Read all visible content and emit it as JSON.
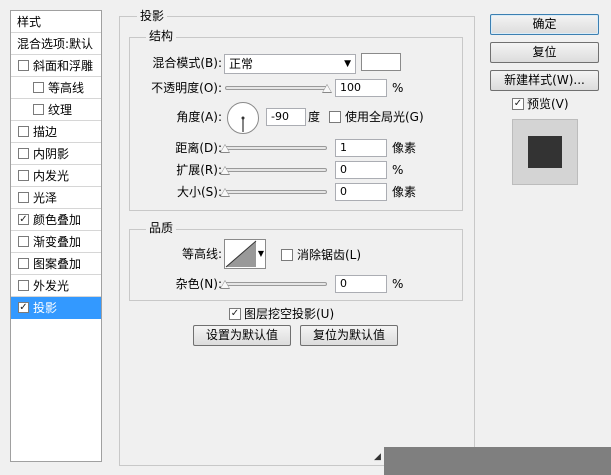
{
  "sidebar": {
    "header": "样式",
    "blend_options": "混合选项:默认",
    "items": [
      {
        "label": "斜面和浮雕",
        "checked": false,
        "selected": false,
        "indent": false
      },
      {
        "label": "等高线",
        "checked": false,
        "selected": false,
        "indent": true
      },
      {
        "label": "纹理",
        "checked": false,
        "selected": false,
        "indent": true
      },
      {
        "label": "描边",
        "checked": false,
        "selected": false,
        "indent": false
      },
      {
        "label": "内阴影",
        "checked": false,
        "selected": false,
        "indent": false
      },
      {
        "label": "内发光",
        "checked": false,
        "selected": false,
        "indent": false
      },
      {
        "label": "光泽",
        "checked": false,
        "selected": false,
        "indent": false
      },
      {
        "label": "颜色叠加",
        "checked": true,
        "selected": false,
        "indent": false
      },
      {
        "label": "渐变叠加",
        "checked": false,
        "selected": false,
        "indent": false
      },
      {
        "label": "图案叠加",
        "checked": false,
        "selected": false,
        "indent": false
      },
      {
        "label": "外发光",
        "checked": false,
        "selected": false,
        "indent": false
      },
      {
        "label": "投影",
        "checked": true,
        "selected": true,
        "indent": false
      }
    ]
  },
  "panel": {
    "title": "投影",
    "structure": {
      "title": "结构",
      "blend_mode_label": "混合模式(B):",
      "blend_mode_value": "正常",
      "opacity_label": "不透明度(O):",
      "opacity_value": "100",
      "opacity_unit": "%",
      "opacity_fraction": 1.0,
      "angle_label": "角度(A):",
      "angle_value": "-90",
      "angle_unit": "度",
      "global_light_label": "使用全局光(G)",
      "global_light_checked": false,
      "distance_label": "距离(D):",
      "distance_value": "1",
      "distance_unit": "像素",
      "distance_fraction": 0.0,
      "spread_label": "扩展(R):",
      "spread_value": "0",
      "spread_unit": "%",
      "spread_fraction": 0.0,
      "size_label": "大小(S):",
      "size_value": "0",
      "size_unit": "像素",
      "size_fraction": 0.0
    },
    "quality": {
      "title": "品质",
      "contour_label": "等高线:",
      "anti_alias_label": "消除锯齿(L)",
      "anti_alias_checked": false,
      "noise_label": "杂色(N):",
      "noise_value": "0",
      "noise_unit": "%",
      "noise_fraction": 0.0
    },
    "knockout_label": "图层挖空投影(U)",
    "knockout_checked": true,
    "make_default_label": "设置为默认值",
    "reset_default_label": "复位为默认值"
  },
  "actions": {
    "ok_label": "确定",
    "reset_label": "复位",
    "new_style_label": "新建样式(W)...",
    "preview_label": "预览(V)",
    "preview_checked": true
  },
  "colors": {
    "selection": "#3399ff",
    "preview_swatch": "#333333"
  }
}
